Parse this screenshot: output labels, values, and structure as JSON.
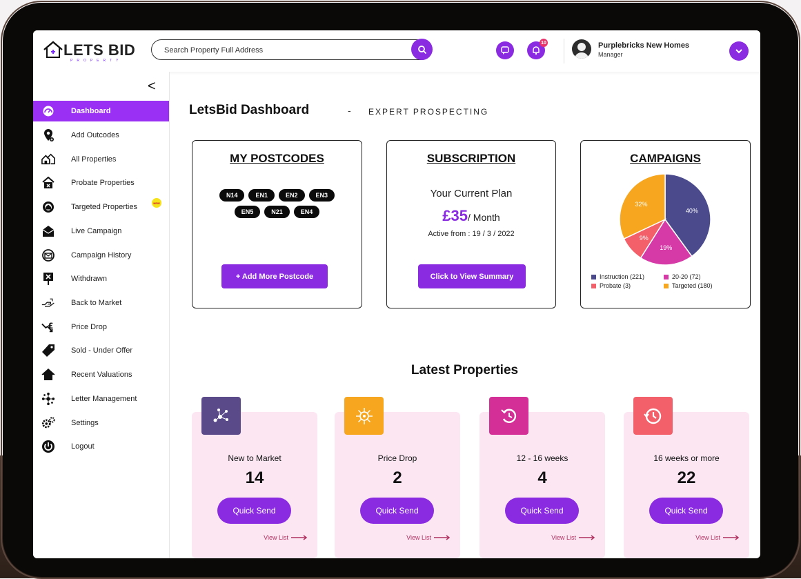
{
  "app": {
    "logo_text": "LETS BID",
    "logo_sub": "PROPERTY"
  },
  "search": {
    "placeholder": "Search Property Full Address"
  },
  "header": {
    "notification_count": "10",
    "user_name": "Purplebricks New Homes",
    "user_role": "Manager"
  },
  "sidebar": {
    "collapse_glyph": "<",
    "items": [
      {
        "label": "Dashboard",
        "icon": "dashboard-icon",
        "active": true
      },
      {
        "label": "Add Outcodes",
        "icon": "location-pin-icon"
      },
      {
        "label": "All Properties",
        "icon": "houses-icon"
      },
      {
        "label": "Probate Properties",
        "icon": "probate-house-icon"
      },
      {
        "label": "Targeted Properties",
        "icon": "target-house-icon",
        "badge": "NEW"
      },
      {
        "label": "Live Campaign",
        "icon": "live-mail-icon"
      },
      {
        "label": "Campaign History",
        "icon": "campaign-history-icon"
      },
      {
        "label": "Withdrawn",
        "icon": "withdrawn-sign-icon"
      },
      {
        "label": "Back to Market",
        "icon": "hand-offer-icon"
      },
      {
        "label": "Price Drop",
        "icon": "price-drop-icon"
      },
      {
        "label": "Sold - Under Offer",
        "icon": "sold-tag-icon"
      },
      {
        "label": "Recent Valuations",
        "icon": "house-icon"
      },
      {
        "label": "Letter Management",
        "icon": "network-icon"
      },
      {
        "label": "Settings",
        "icon": "settings-gears-icon"
      },
      {
        "label": "Logout",
        "icon": "power-icon"
      }
    ]
  },
  "dashboard": {
    "title": "LetsBid Dashboard",
    "separator": "-",
    "subtitle": "EXPERT PROSPECTING"
  },
  "postcodes": {
    "title": "MY POSTCODES",
    "chips": [
      "N14",
      "EN1",
      "EN2",
      "EN3",
      "EN5",
      "N21",
      "EN4"
    ],
    "button": "+ Add More Postcode"
  },
  "subscription": {
    "title": "SUBSCRIPTION",
    "plan_label": "Your Current Plan",
    "price": "£35",
    "period": "/ Month",
    "active_from": "Active from : 19 / 3 / 2022",
    "button": "Click to View Summary"
  },
  "campaigns": {
    "title": "CAMPAIGNS",
    "legend": [
      {
        "label": "Instruction (221)",
        "color": "#4b4a8c"
      },
      {
        "label": "20-20 (72)",
        "color": "#d63aa7"
      },
      {
        "label": "Probate (3)",
        "color": "#f3606a"
      },
      {
        "label": "Targeted (180)",
        "color": "#f7a71f"
      }
    ]
  },
  "chart_data": {
    "type": "pie",
    "slices": [
      {
        "name": "Instruction",
        "value": 40,
        "label": "40%",
        "color": "#4b4a8c"
      },
      {
        "name": "20-20",
        "value": 19,
        "label": "19%",
        "color": "#d63aa7"
      },
      {
        "name": "Probate",
        "value": 9,
        "label": "9%",
        "color": "#f3606a"
      },
      {
        "name": "Targeted",
        "value": 32,
        "label": "32%",
        "color": "#f7a71f"
      }
    ],
    "legend_placement": "bottom"
  },
  "latest": {
    "title": "Latest Properties",
    "cards": [
      {
        "name": "New to Market",
        "count": "14",
        "button": "Quick Send",
        "link": "View List",
        "icon": "network-nodes-icon",
        "color": "#5a4a8a"
      },
      {
        "name": "Price Drop",
        "count": "2",
        "button": "Quick Send",
        "link": "View List",
        "icon": "virus-burst-icon",
        "color": "#f7a71f"
      },
      {
        "name": "12 - 16 weeks",
        "count": "4",
        "button": "Quick Send",
        "link": "View List",
        "icon": "history-arrow-icon",
        "color": "#d42f96"
      },
      {
        "name": "16 weeks or more",
        "count": "22",
        "button": "Quick Send",
        "link": "View List",
        "icon": "clock-history-icon",
        "color": "#f3606a"
      }
    ]
  }
}
